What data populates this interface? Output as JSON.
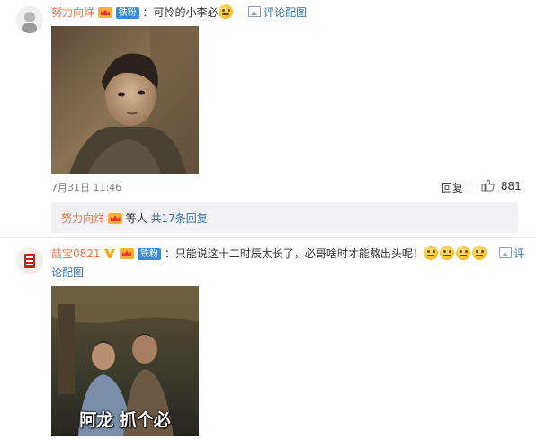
{
  "comments": [
    {
      "username": "努力向烊",
      "text": "：可怜的小李必",
      "fan_badge": "铁粉",
      "link_label": "评论配图",
      "timestamp": "7月31日 11:46",
      "reply_label": "回复",
      "like_count": "881",
      "reply_summary": {
        "name": "努力向烊",
        "text": "等人",
        "link": "共17条回复"
      }
    },
    {
      "username": "喆宝0821",
      "fan_badge": "铁粉",
      "text": "：只能说这十二时辰太长了，必哥啥时才能熬出头呢！",
      "link_label_1": "评",
      "link_label_2": "论配图",
      "image_caption": "阿龙 抓个必"
    }
  ],
  "colors": {
    "username": "#eb7350",
    "link": "#3b6fa0",
    "fan_badge": "#3b8ad8",
    "reply_box": "#f2f2f5"
  }
}
